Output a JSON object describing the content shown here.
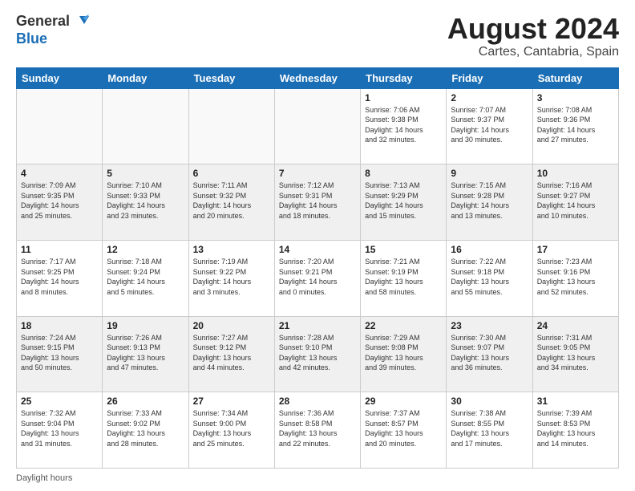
{
  "logo": {
    "line1": "General",
    "line2": "Blue"
  },
  "title": "August 2024",
  "subtitle": "Cartes, Cantabria, Spain",
  "days_of_week": [
    "Sunday",
    "Monday",
    "Tuesday",
    "Wednesday",
    "Thursday",
    "Friday",
    "Saturday"
  ],
  "weeks": [
    [
      {
        "day": "",
        "info": ""
      },
      {
        "day": "",
        "info": ""
      },
      {
        "day": "",
        "info": ""
      },
      {
        "day": "",
        "info": ""
      },
      {
        "day": "1",
        "info": "Sunrise: 7:06 AM\nSunset: 9:38 PM\nDaylight: 14 hours\nand 32 minutes."
      },
      {
        "day": "2",
        "info": "Sunrise: 7:07 AM\nSunset: 9:37 PM\nDaylight: 14 hours\nand 30 minutes."
      },
      {
        "day": "3",
        "info": "Sunrise: 7:08 AM\nSunset: 9:36 PM\nDaylight: 14 hours\nand 27 minutes."
      }
    ],
    [
      {
        "day": "4",
        "info": "Sunrise: 7:09 AM\nSunset: 9:35 PM\nDaylight: 14 hours\nand 25 minutes."
      },
      {
        "day": "5",
        "info": "Sunrise: 7:10 AM\nSunset: 9:33 PM\nDaylight: 14 hours\nand 23 minutes."
      },
      {
        "day": "6",
        "info": "Sunrise: 7:11 AM\nSunset: 9:32 PM\nDaylight: 14 hours\nand 20 minutes."
      },
      {
        "day": "7",
        "info": "Sunrise: 7:12 AM\nSunset: 9:31 PM\nDaylight: 14 hours\nand 18 minutes."
      },
      {
        "day": "8",
        "info": "Sunrise: 7:13 AM\nSunset: 9:29 PM\nDaylight: 14 hours\nand 15 minutes."
      },
      {
        "day": "9",
        "info": "Sunrise: 7:15 AM\nSunset: 9:28 PM\nDaylight: 14 hours\nand 13 minutes."
      },
      {
        "day": "10",
        "info": "Sunrise: 7:16 AM\nSunset: 9:27 PM\nDaylight: 14 hours\nand 10 minutes."
      }
    ],
    [
      {
        "day": "11",
        "info": "Sunrise: 7:17 AM\nSunset: 9:25 PM\nDaylight: 14 hours\nand 8 minutes."
      },
      {
        "day": "12",
        "info": "Sunrise: 7:18 AM\nSunset: 9:24 PM\nDaylight: 14 hours\nand 5 minutes."
      },
      {
        "day": "13",
        "info": "Sunrise: 7:19 AM\nSunset: 9:22 PM\nDaylight: 14 hours\nand 3 minutes."
      },
      {
        "day": "14",
        "info": "Sunrise: 7:20 AM\nSunset: 9:21 PM\nDaylight: 14 hours\nand 0 minutes."
      },
      {
        "day": "15",
        "info": "Sunrise: 7:21 AM\nSunset: 9:19 PM\nDaylight: 13 hours\nand 58 minutes."
      },
      {
        "day": "16",
        "info": "Sunrise: 7:22 AM\nSunset: 9:18 PM\nDaylight: 13 hours\nand 55 minutes."
      },
      {
        "day": "17",
        "info": "Sunrise: 7:23 AM\nSunset: 9:16 PM\nDaylight: 13 hours\nand 52 minutes."
      }
    ],
    [
      {
        "day": "18",
        "info": "Sunrise: 7:24 AM\nSunset: 9:15 PM\nDaylight: 13 hours\nand 50 minutes."
      },
      {
        "day": "19",
        "info": "Sunrise: 7:26 AM\nSunset: 9:13 PM\nDaylight: 13 hours\nand 47 minutes."
      },
      {
        "day": "20",
        "info": "Sunrise: 7:27 AM\nSunset: 9:12 PM\nDaylight: 13 hours\nand 44 minutes."
      },
      {
        "day": "21",
        "info": "Sunrise: 7:28 AM\nSunset: 9:10 PM\nDaylight: 13 hours\nand 42 minutes."
      },
      {
        "day": "22",
        "info": "Sunrise: 7:29 AM\nSunset: 9:08 PM\nDaylight: 13 hours\nand 39 minutes."
      },
      {
        "day": "23",
        "info": "Sunrise: 7:30 AM\nSunset: 9:07 PM\nDaylight: 13 hours\nand 36 minutes."
      },
      {
        "day": "24",
        "info": "Sunrise: 7:31 AM\nSunset: 9:05 PM\nDaylight: 13 hours\nand 34 minutes."
      }
    ],
    [
      {
        "day": "25",
        "info": "Sunrise: 7:32 AM\nSunset: 9:04 PM\nDaylight: 13 hours\nand 31 minutes."
      },
      {
        "day": "26",
        "info": "Sunrise: 7:33 AM\nSunset: 9:02 PM\nDaylight: 13 hours\nand 28 minutes."
      },
      {
        "day": "27",
        "info": "Sunrise: 7:34 AM\nSunset: 9:00 PM\nDaylight: 13 hours\nand 25 minutes."
      },
      {
        "day": "28",
        "info": "Sunrise: 7:36 AM\nSunset: 8:58 PM\nDaylight: 13 hours\nand 22 minutes."
      },
      {
        "day": "29",
        "info": "Sunrise: 7:37 AM\nSunset: 8:57 PM\nDaylight: 13 hours\nand 20 minutes."
      },
      {
        "day": "30",
        "info": "Sunrise: 7:38 AM\nSunset: 8:55 PM\nDaylight: 13 hours\nand 17 minutes."
      },
      {
        "day": "31",
        "info": "Sunrise: 7:39 AM\nSunset: 8:53 PM\nDaylight: 13 hours\nand 14 minutes."
      }
    ]
  ],
  "footer": "Daylight hours"
}
